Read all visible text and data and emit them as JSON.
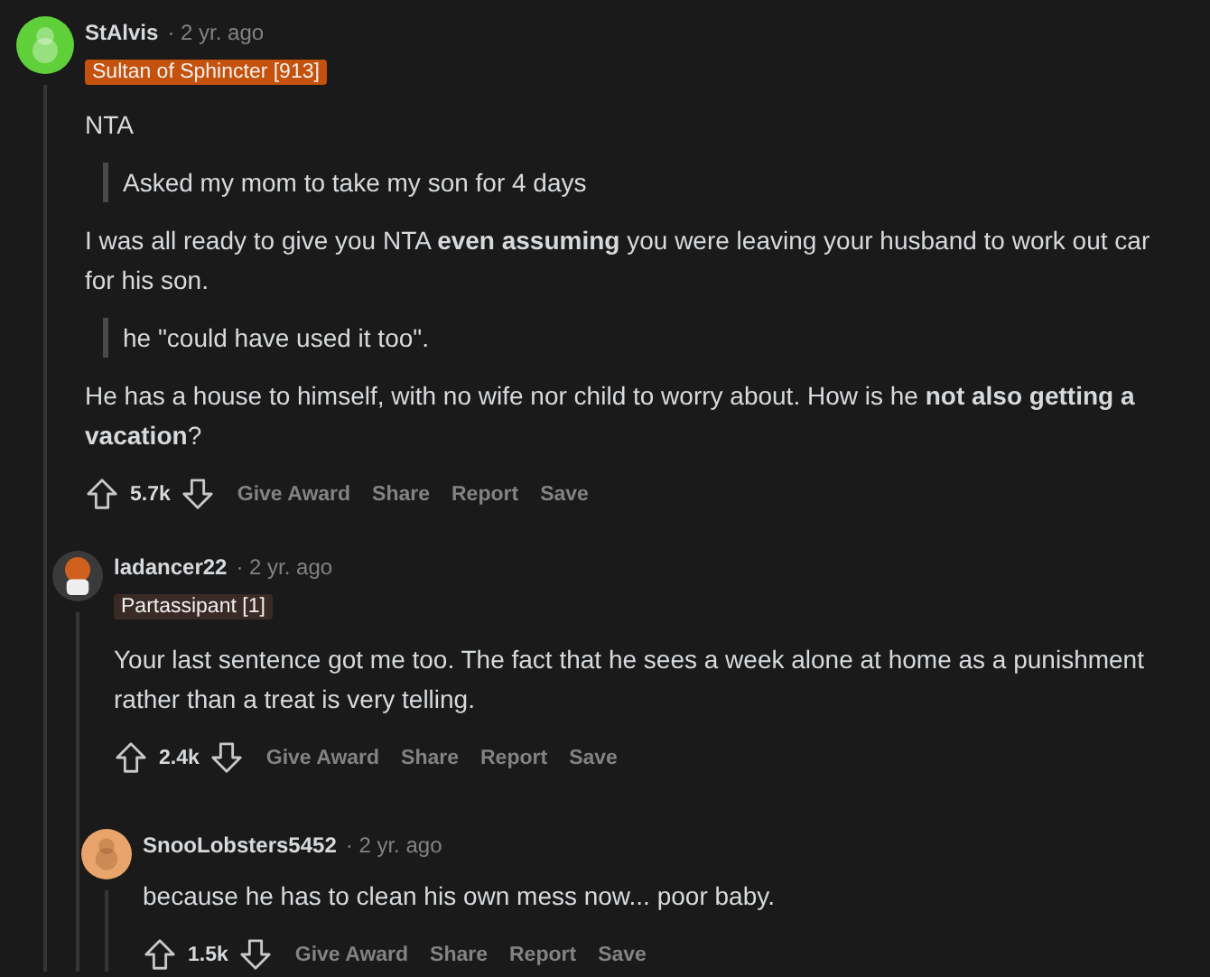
{
  "comments": [
    {
      "username": "StAlvis",
      "age": "· 2 yr. ago",
      "color": "#5fcf3a",
      "flair": {
        "text": "Sultan of Sphincter [913]",
        "color": "#c4520c"
      },
      "blocks": [
        {
          "kind": "text",
          "lines": [
            "NTA"
          ]
        },
        {
          "kind": "quote",
          "lines": [
            "Asked my mom to take my son for 4 days"
          ]
        },
        {
          "kind": "text",
          "lines": [
            "I was all ready to give you NTA **even assuming** you were leaving your husband to work out car",
            "for his son."
          ]
        },
        {
          "kind": "quote",
          "lines": [
            "he \"could have used it too\"."
          ]
        },
        {
          "kind": "text",
          "lines": [
            "He has a house to himself, with no wife nor child to worry about. How is he **not also getting a**",
            "**vacation**?"
          ]
        }
      ],
      "score": "5.7k",
      "actions": [
        "Give Award",
        "Share",
        "Report",
        "Save"
      ],
      "replies": [
        {
          "username": "ladancer22",
          "age": "· 2 yr. ago",
          "color": "#3a3a3a",
          "flair": {
            "text": "Partassipant [1]",
            "color": "#3a2a25"
          },
          "blocks": [
            {
              "kind": "text",
              "lines": [
                "Your last sentence got me too. The fact that he sees a week alone at home as a punishment",
                "rather than a treat is very telling."
              ]
            }
          ],
          "score": "2.4k",
          "actions": [
            "Give Award",
            "Share",
            "Report",
            "Save"
          ],
          "replies": [
            {
              "username": "SnooLobsters5452",
              "age": "· 2 yr. ago",
              "color": "#e8a46a",
              "blocks": [
                {
                  "kind": "text",
                  "lines": [
                    "because he has to clean his own mess now... poor baby."
                  ]
                }
              ],
              "score": "1.5k",
              "actions": [
                "Give Award",
                "Share",
                "Report",
                "Save"
              ]
            }
          ]
        }
      ]
    }
  ]
}
